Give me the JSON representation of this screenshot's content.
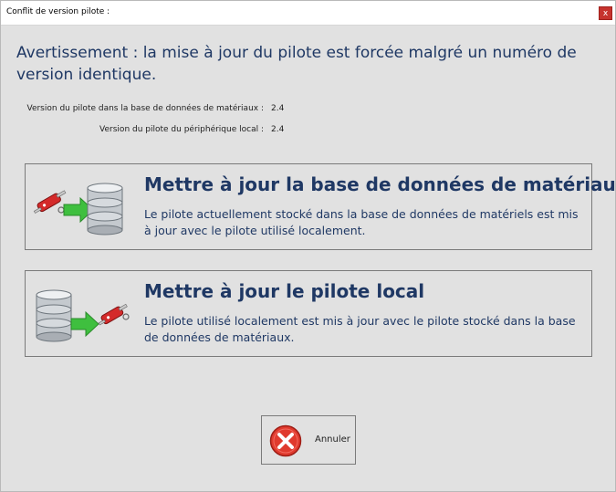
{
  "window": {
    "title": "Conflit de version pilote :",
    "close_label": "x"
  },
  "warning": {
    "text": "Avertissement : la mise à jour du pilote est forcée malgré un numéro de version identique."
  },
  "info": [
    {
      "label": "Version du pilote dans la base de données de matériaux :",
      "value": "2.4"
    },
    {
      "label": "Version du pilote du périphérique local :",
      "value": "2.4"
    }
  ],
  "actions": [
    {
      "title": "Mettre à jour la base de données de matériaux",
      "description": "Le pilote actuellement stocké dans la base de données de matériels est mis à jour avec le pilote utilisé localement.",
      "icon": "knife-to-database-icon"
    },
    {
      "title": "Mettre à jour le pilote local",
      "description": "Le pilote utilisé localement est mis à jour avec le pilote stocké dans la base de données de matériaux.",
      "icon": "database-to-knife-icon"
    }
  ],
  "cancel": {
    "label": "Annuler",
    "icon": "cancel-icon"
  },
  "colors": {
    "heading": "#1f3864",
    "background": "#e1e1e1",
    "close_button": "#c6332e",
    "cancel_red": "#e03a2e",
    "arrow_green": "#3fbf3f"
  }
}
